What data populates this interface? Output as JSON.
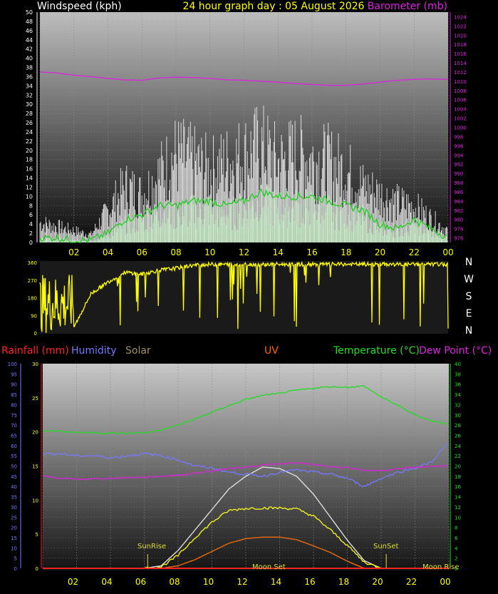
{
  "header": {
    "left_title": "Windspeed (kph)",
    "center_title": "24 hour graph day : 05 August 2026",
    "right_title": "Barometer (mb)"
  },
  "colors": {
    "background": "#000000",
    "wind_gust": "#e8e8e8",
    "wind_avg": "#c8f0c8",
    "wind_avg_line": "#22cc22",
    "barometer": "#dd22dd",
    "direction": "#ffff00",
    "rainfall": "#ff2222",
    "humidity": "#7777ff",
    "solar": "#a09060",
    "uv": "#ff6600",
    "temperature": "#22dd22",
    "dew_point": "#dd22dd",
    "solar_max": "#dddddd",
    "solar_curve": "#eeee22",
    "uv_curve": "#dd6611",
    "annotation": "#dddd33"
  },
  "x_ticks": [
    "02",
    "04",
    "06",
    "08",
    "10",
    "12",
    "14",
    "16",
    "18",
    "20",
    "22",
    "00"
  ],
  "wind_chart": {
    "left_axis_ticks": [
      "0",
      "2",
      "4",
      "6",
      "8",
      "10",
      "12",
      "14",
      "16",
      "18",
      "20",
      "22",
      "24",
      "26",
      "28",
      "30",
      "32",
      "34",
      "36",
      "38",
      "40",
      "42",
      "44",
      "46",
      "48",
      "50"
    ],
    "right_axis_ticks": [
      "976",
      "978",
      "980",
      "982",
      "984",
      "986",
      "988",
      "990",
      "992",
      "994",
      "996",
      "998",
      "1000",
      "1002",
      "1004",
      "1006",
      "1008",
      "1010",
      "1012",
      "1014",
      "1016",
      "1018",
      "1020",
      "1022",
      "1024"
    ]
  },
  "direction_chart": {
    "left_ticks": [
      "0",
      "90",
      "180",
      "270",
      "360"
    ],
    "right_labels": [
      "N",
      "W",
      "S",
      "E",
      "N"
    ]
  },
  "lower_header": {
    "rainfall": "Rainfall (mm)",
    "humidity": "Humidity",
    "solar": "Solar",
    "uv": "UV",
    "temperature": "Temperature (°C)",
    "dew_point": "Dew Point (°C)"
  },
  "lower_chart": {
    "humidity_ticks": [
      "0",
      "5",
      "10",
      "15",
      "20",
      "25",
      "30",
      "35",
      "40",
      "45",
      "50",
      "55",
      "60",
      "65",
      "70",
      "75",
      "80",
      "85",
      "90",
      "95",
      "100"
    ],
    "rain_ticks": [
      "0",
      "5",
      "10",
      "15",
      "20",
      "25",
      "30"
    ],
    "temp_ticks": [
      "0",
      "2",
      "4",
      "6",
      "8",
      "10",
      "12",
      "14",
      "16",
      "18",
      "20",
      "22",
      "24",
      "26",
      "28",
      "30",
      "32",
      "34",
      "36",
      "38",
      "40"
    ],
    "annotations": {
      "sunrise": "SunRise",
      "sunset": "SunSet",
      "moonset": "Moon Set",
      "moonrise": "Moon Rise"
    }
  },
  "chart_data": [
    {
      "type": "line",
      "title": "24 hour graph day : 05 August 2026",
      "xlabel": "",
      "ylabel": "Windspeed (kph)",
      "y2label": "Barometer (mb)",
      "ylim": [
        0,
        50
      ],
      "y2lim": [
        975,
        1025
      ],
      "x": [
        0,
        1,
        2,
        3,
        4,
        5,
        6,
        7,
        8,
        9,
        10,
        11,
        12,
        13,
        14,
        15,
        16,
        17,
        18,
        19,
        20,
        21,
        22,
        23,
        24
      ],
      "series": [
        {
          "name": "Windspeed (kph)",
          "kind": "gust",
          "values": [
            5,
            4,
            3,
            2,
            8,
            14,
            12,
            17,
            22,
            20,
            18,
            20,
            22,
            24,
            20,
            22,
            21,
            20,
            18,
            14,
            12,
            10,
            9,
            6,
            3
          ]
        },
        {
          "name": "Windspeed (kph)",
          "kind": "average",
          "values": [
            1,
            1,
            0.5,
            0.5,
            2,
            5,
            6,
            8,
            8,
            9,
            9,
            8,
            9,
            11,
            10,
            10,
            10,
            9,
            8,
            7,
            4,
            3,
            5,
            3,
            1
          ]
        },
        {
          "name": "Barometer (mb)",
          "values": [
            1012,
            1011.8,
            1011.3,
            1011,
            1010.6,
            1010.3,
            1010.2,
            1010.7,
            1010.9,
            1010.8,
            1010.6,
            1010.3,
            1010.2,
            1010,
            1009.8,
            1009.5,
            1009.3,
            1009.1,
            1009.1,
            1009.4,
            1009.8,
            1010.2,
            1010.4,
            1010.5,
            1010.4
          ]
        }
      ]
    },
    {
      "type": "scatter",
      "title": "",
      "ylabel": "",
      "ylim": [
        0,
        360
      ],
      "x": [
        0,
        1,
        2,
        3,
        4,
        5,
        6,
        7,
        8,
        9,
        10,
        11,
        12,
        13,
        14,
        15,
        16,
        17,
        18,
        19,
        20,
        21,
        22,
        23,
        24
      ],
      "series": [
        {
          "name": "",
          "values": [
            50,
            300,
            30,
            200,
            260,
            310,
            300,
            320,
            330,
            345,
            350,
            350,
            350,
            350,
            350,
            350,
            350,
            350,
            350,
            350,
            350,
            350,
            350,
            350,
            350
          ]
        }
      ]
    },
    {
      "type": "line",
      "title": "",
      "ylim_humidity": [
        0,
        100
      ],
      "ylim_rain": [
        0,
        30
      ],
      "ylim_temp": [
        0,
        40
      ],
      "x": [
        0,
        1,
        2,
        3,
        4,
        5,
        6,
        7,
        8,
        9,
        10,
        11,
        12,
        13,
        14,
        15,
        16,
        17,
        18,
        19,
        20,
        21,
        22,
        23,
        24
      ],
      "series": [
        {
          "name": "Temperature (°C)",
          "values": [
            27,
            26.8,
            26.6,
            26.5,
            26.4,
            26.4,
            26.5,
            27,
            28,
            29.2,
            30.5,
            31.8,
            33,
            33.8,
            34.2,
            34.8,
            35.2,
            35.5,
            35.4,
            35.6,
            33.5,
            31.8,
            30,
            28.8,
            28.2
          ]
        },
        {
          "name": "Humidity",
          "values": [
            56,
            56,
            55,
            55,
            54,
            55,
            56,
            55,
            53,
            50,
            49,
            47,
            46,
            45,
            47,
            48,
            47,
            46,
            44,
            40,
            44,
            47,
            49,
            52,
            62
          ]
        },
        {
          "name": "Dew Point (°C)",
          "values": [
            18,
            17.6,
            17.4,
            17.5,
            17.6,
            17.7,
            17.8,
            18,
            18.2,
            18.6,
            19,
            19.5,
            19.8,
            20.2,
            20.4,
            20.6,
            20.3,
            19.9,
            19.6,
            19.2,
            19.1,
            19.4,
            19.7,
            20,
            19.9
          ]
        },
        {
          "name": "Solar",
          "values": [
            0,
            0,
            0,
            0,
            0,
            0,
            0,
            0.5,
            3.5,
            7.5,
            11.5,
            15.5,
            18,
            19.8,
            19.5,
            18,
            14.5,
            10,
            5.5,
            1.5,
            0,
            0,
            0,
            0,
            0
          ]
        },
        {
          "name": "Solar",
          "kind": "measured",
          "values": [
            0,
            0,
            0,
            0,
            0,
            0,
            0,
            0.3,
            2.5,
            6,
            9,
            11.3,
            11.7,
            11.8,
            11.8,
            11.6,
            10.2,
            7.5,
            4.5,
            1.2,
            0,
            0,
            0,
            0,
            0
          ]
        },
        {
          "name": "UV",
          "values": [
            0,
            0,
            0,
            0,
            0,
            0,
            0,
            0,
            0.5,
            1.7,
            3.3,
            4.9,
            5.8,
            6.1,
            6.1,
            5.6,
            4.4,
            3.1,
            1.4,
            0,
            0,
            0,
            0,
            0,
            0
          ]
        },
        {
          "name": "Rainfall (mm)",
          "values": [
            0,
            0,
            0,
            0,
            0,
            0,
            0,
            0,
            0,
            0,
            0,
            0,
            0,
            0,
            0,
            0,
            0,
            0,
            0,
            0,
            0,
            0,
            0,
            0,
            0
          ]
        }
      ]
    }
  ]
}
